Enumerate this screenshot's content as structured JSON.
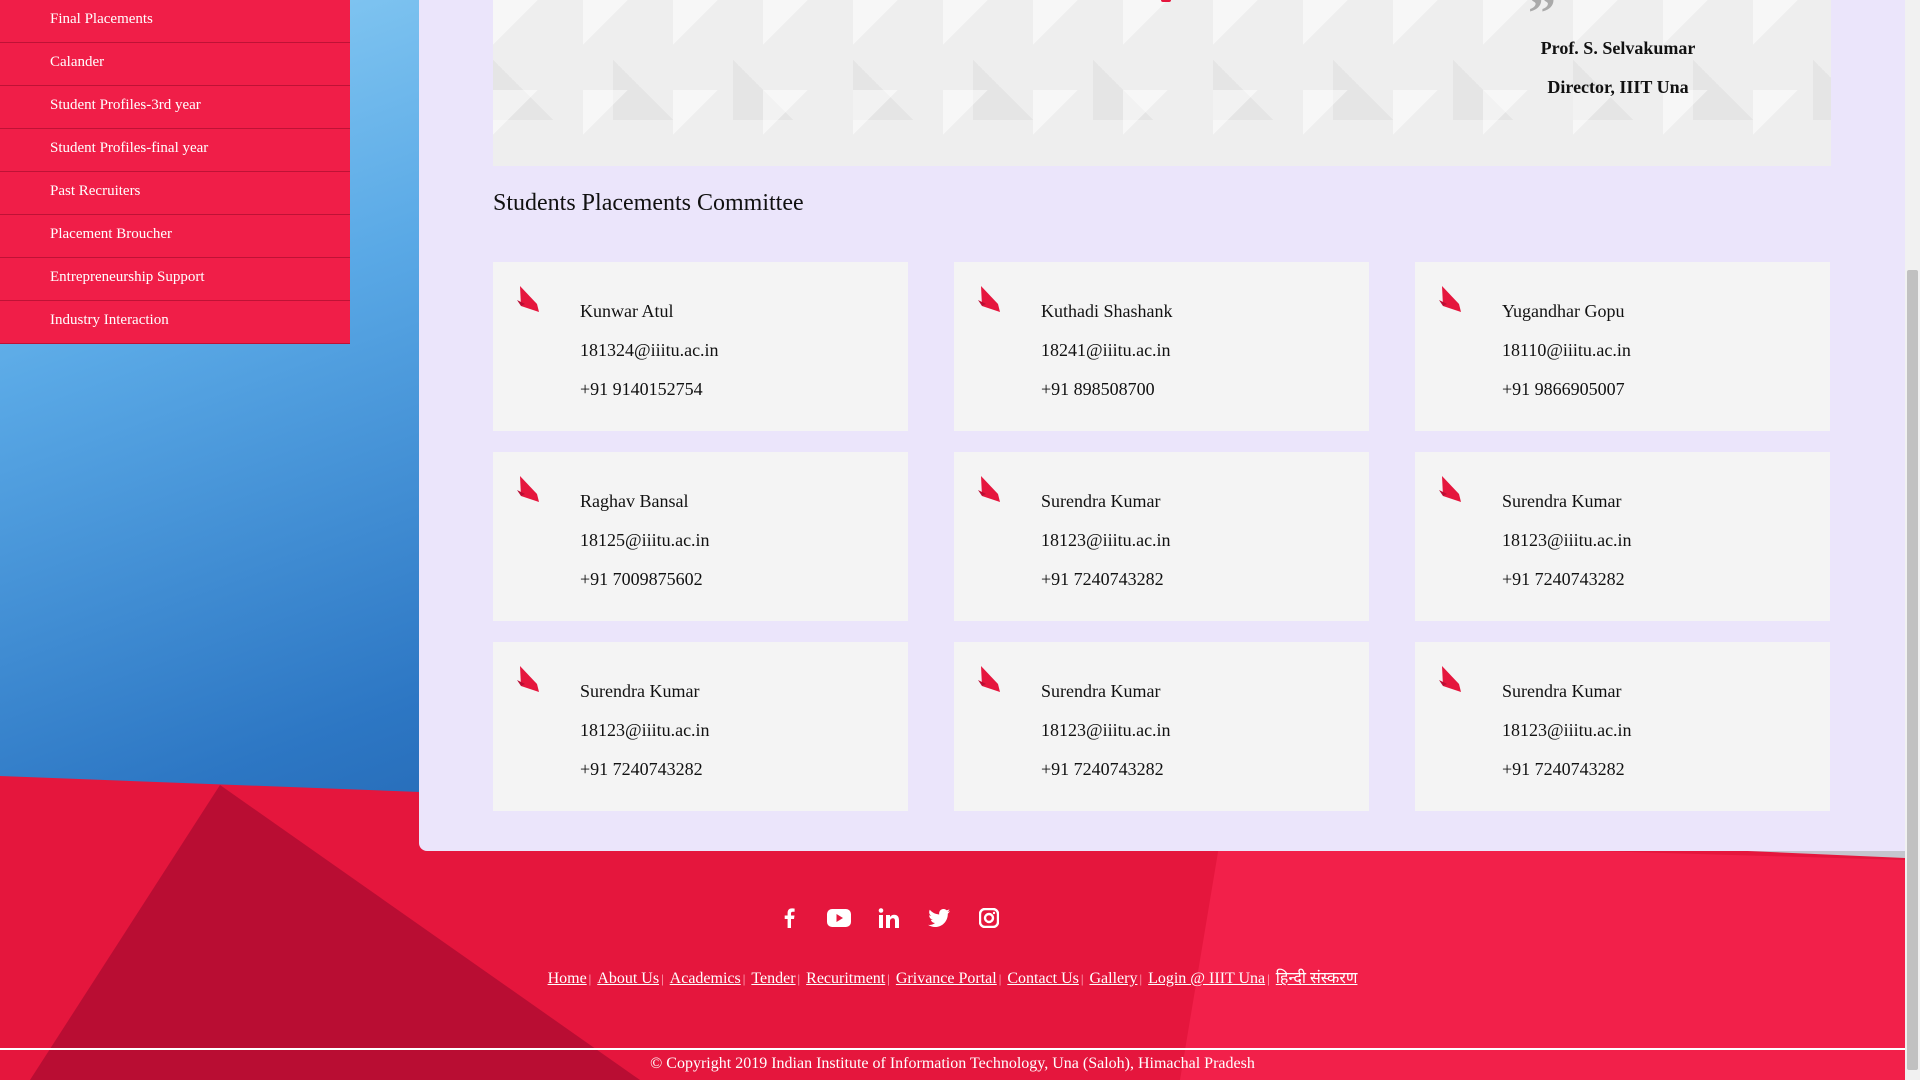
{
  "sidebar": {
    "items": [
      {
        "label": "Final Placements"
      },
      {
        "label": "Calander"
      },
      {
        "label": "Student Profiles-3rd year"
      },
      {
        "label": "Student Profiles-final year"
      },
      {
        "label": "Past Recruiters"
      },
      {
        "label": "Placement Broucher"
      },
      {
        "label": "Entrepreneurship Support"
      },
      {
        "label": "Industry Interaction"
      }
    ]
  },
  "director": {
    "quote_mark": "”",
    "name": "Prof. S. Selvakumar",
    "title": "Director, IIIT Una"
  },
  "committee": {
    "title": "Students Placements Committee",
    "members": [
      {
        "name": "Kunwar Atul",
        "email": "181324@iiitu.ac.in",
        "phone": "+91 9140152754"
      },
      {
        "name": "Kuthadi Shashank",
        "email": "18241@iiitu.ac.in",
        "phone": "+91 898508700"
      },
      {
        "name": "Yugandhar Gopu",
        "email": "18110@iiitu.ac.in",
        "phone": "+91 9866905007"
      },
      {
        "name": "Raghav Bansal",
        "email": "18125@iiitu.ac.in",
        "phone": "+91 7009875602"
      },
      {
        "name": "Surendra Kumar",
        "email": "18123@iiitu.ac.in",
        "phone": "+91 7240743282"
      },
      {
        "name": "Surendra Kumar",
        "email": "18123@iiitu.ac.in",
        "phone": "+91 7240743282"
      },
      {
        "name": "Surendra Kumar",
        "email": "18123@iiitu.ac.in",
        "phone": "+91 7240743282"
      },
      {
        "name": "Surendra Kumar",
        "email": "18123@iiitu.ac.in",
        "phone": "+91 7240743282"
      },
      {
        "name": "Surendra Kumar",
        "email": "18123@iiitu.ac.in",
        "phone": "+91 7240743282"
      }
    ]
  },
  "social": [
    {
      "icon": "facebook-icon"
    },
    {
      "icon": "youtube-icon"
    },
    {
      "icon": "linkedin-icon"
    },
    {
      "icon": "twitter-icon"
    },
    {
      "icon": "instagram-icon"
    }
  ],
  "footer": {
    "links": [
      {
        "label": "Home"
      },
      {
        "label": "About Us"
      },
      {
        "label": "Academics"
      },
      {
        "label": "Tender"
      },
      {
        "label": "Recuritment"
      },
      {
        "label": "Grivance Portal"
      },
      {
        "label": "Contact Us"
      },
      {
        "label": "Gallery"
      },
      {
        "label": "Login @ IIIT Una"
      },
      {
        "label": "हिन्दी संस्करण"
      }
    ],
    "separator": "|",
    "copyright": "© Copyright 2019 Indian Institute of Information Technology, Una (Saloh), Himachal Pradesh"
  },
  "colors": {
    "accent": "#e5163d",
    "sidebar": "#f01e48",
    "panel": "#ebe5fb",
    "card": "#f4f4f4"
  }
}
